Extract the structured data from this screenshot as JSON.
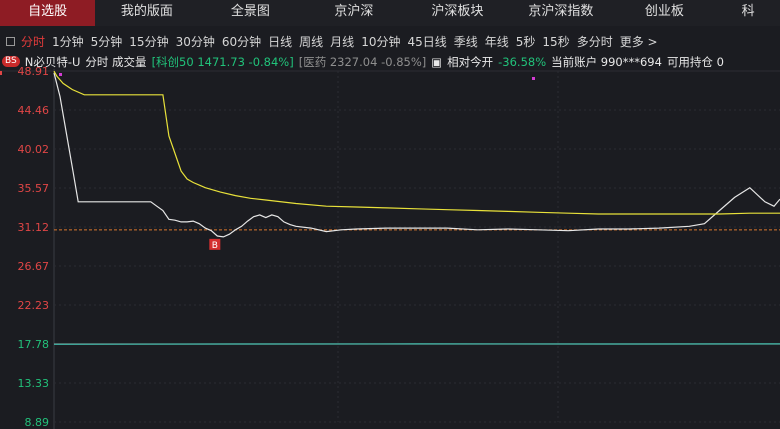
{
  "nav": {
    "tabs": [
      {
        "label": "自选股",
        "active": true
      },
      {
        "label": "我的版面",
        "active": false
      },
      {
        "label": "全景图",
        "active": false
      },
      {
        "label": "京沪深",
        "active": false
      },
      {
        "label": "沪深板块",
        "active": false
      },
      {
        "label": "京沪深指数",
        "active": false
      },
      {
        "label": "创业板",
        "active": false
      },
      {
        "label": "科",
        "active": false
      }
    ]
  },
  "periods": {
    "items": [
      "分时",
      "1分钟",
      "5分钟",
      "15分钟",
      "30分钟",
      "60分钟",
      "日线",
      "周线",
      "月线",
      "10分钟",
      "45日线",
      "季线",
      "年线",
      "5秒",
      "15秒",
      "多分时",
      "更多 >"
    ],
    "active_index": 0
  },
  "info": {
    "bs_label": "BS",
    "stock_name": "N必贝特-U",
    "chart_label": "分时 成交量",
    "index1": "[科创50 1471.73 -0.84%]",
    "index2": "[医药 2327.04 -0.85%]",
    "relative_label": "相对今开",
    "relative_value": "-36.58%",
    "account_label": "当前账户 990***694",
    "position_label": "可用持仓 0"
  },
  "chart_data": {
    "type": "line",
    "y_ticks": [
      "48.91",
      "44.46",
      "40.02",
      "35.57",
      "31.12",
      "26.67",
      "22.23",
      "17.78",
      "13.33",
      "8.89"
    ],
    "ylim": [
      8.89,
      48.91
    ],
    "reference_price": 30.8,
    "buy_marker": {
      "label": "B",
      "price": 30.0
    },
    "series": [
      {
        "color": "#e6e6e6",
        "x": [
          0,
          2,
          4,
          6,
          8,
          10,
          12,
          15,
          18,
          21,
          24,
          26,
          28,
          30,
          32,
          34,
          36,
          38,
          40,
          42,
          44,
          46,
          48,
          50,
          52,
          54,
          56,
          58,
          60,
          62,
          64,
          66,
          68,
          70,
          72,
          74,
          76,
          78,
          80,
          85,
          90,
          95,
          100,
          110,
          120,
          130,
          140,
          150,
          160,
          170,
          180,
          190,
          200,
          210,
          215,
          220,
          225,
          230,
          235,
          238,
          240
        ],
        "y": [
          48.7,
          46,
          42,
          38,
          34,
          34,
          34,
          34,
          34,
          34,
          34,
          34,
          34,
          34,
          34,
          33.5,
          33,
          32,
          31.9,
          31.7,
          31.7,
          31.8,
          31.5,
          31,
          30.7,
          30.1,
          30,
          30.3,
          30.8,
          31.2,
          31.8,
          32.3,
          32.5,
          32.2,
          32.5,
          32.3,
          31.7,
          31.4,
          31.2,
          31.0,
          30.6,
          30.8,
          30.9,
          31.0,
          31.0,
          31.0,
          30.8,
          30.9,
          30.8,
          30.7,
          30.9,
          30.9,
          31.0,
          31.2,
          31.5,
          33,
          34.5,
          35.6,
          34,
          33.5,
          34.3
        ]
      },
      {
        "color": "#e8e13a",
        "x": [
          0,
          1,
          3,
          6,
          10,
          20,
          30,
          36,
          38,
          40,
          42,
          44,
          46,
          48,
          50,
          55,
          60,
          65,
          70,
          80,
          90,
          100,
          110,
          120,
          130,
          140,
          150,
          160,
          170,
          180,
          190,
          200,
          210,
          220,
          230,
          240
        ],
        "y": [
          48.9,
          48.3,
          47.5,
          46.8,
          46.2,
          46.2,
          46.2,
          46.2,
          41.5,
          39.5,
          37.5,
          36.6,
          36.2,
          35.9,
          35.6,
          35.1,
          34.7,
          34.4,
          34.2,
          33.8,
          33.5,
          33.4,
          33.3,
          33.2,
          33.1,
          33.0,
          32.9,
          32.8,
          32.7,
          32.6,
          32.6,
          32.6,
          32.6,
          32.6,
          32.7,
          32.7
        ]
      },
      {
        "color": "#8a8a8a",
        "x": [
          0,
          240
        ],
        "y": [
          17.78,
          17.78
        ]
      },
      {
        "color": "#3fb8a8",
        "x": [
          0,
          60,
          120,
          180,
          240
        ],
        "y": [
          17.75,
          17.78,
          17.79,
          17.78,
          17.8
        ]
      }
    ]
  }
}
